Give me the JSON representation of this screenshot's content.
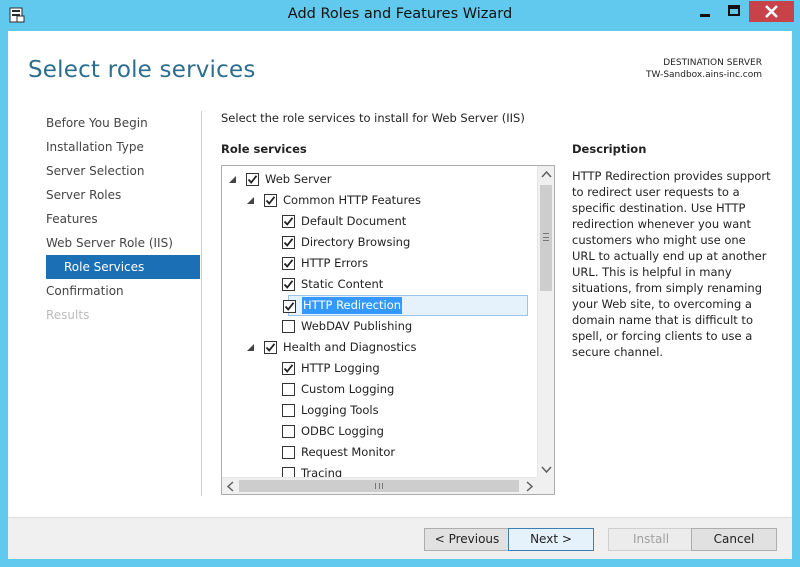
{
  "window": {
    "title": "Add Roles and Features Wizard"
  },
  "header": {
    "page_title": "Select role services",
    "destination_label": "DESTINATION SERVER",
    "destination_server": "TW-Sandbox.ains-inc.com"
  },
  "nav": {
    "items": [
      {
        "label": "Before You Begin",
        "state": "normal"
      },
      {
        "label": "Installation Type",
        "state": "normal"
      },
      {
        "label": "Server Selection",
        "state": "normal"
      },
      {
        "label": "Server Roles",
        "state": "normal"
      },
      {
        "label": "Features",
        "state": "normal"
      },
      {
        "label": "Web Server Role (IIS)",
        "state": "normal"
      },
      {
        "label": "Role Services",
        "state": "active"
      },
      {
        "label": "Confirmation",
        "state": "normal"
      },
      {
        "label": "Results",
        "state": "disabled"
      }
    ]
  },
  "main": {
    "intro": "Select the role services to install for Web Server (IIS)",
    "role_services_label": "Role services",
    "description_label": "Description",
    "description_text": "HTTP Redirection provides support to redirect user requests to a specific destination. Use HTTP redirection whenever you want customers who might use one URL to actually end up at another URL. This is helpful in many situations, from simply renaming your Web site, to overcoming a domain name that is difficult to spell, or forcing clients to use a secure channel."
  },
  "tree": {
    "rows": [
      {
        "label": "Web Server",
        "level": 0,
        "checked": true,
        "expander": "expanded"
      },
      {
        "label": "Common HTTP Features",
        "level": 1,
        "checked": true,
        "expander": "expanded"
      },
      {
        "label": "Default Document",
        "level": 2,
        "checked": true,
        "expander": "none"
      },
      {
        "label": "Directory Browsing",
        "level": 2,
        "checked": true,
        "expander": "none"
      },
      {
        "label": "HTTP Errors",
        "level": 2,
        "checked": true,
        "expander": "none"
      },
      {
        "label": "Static Content",
        "level": 2,
        "checked": true,
        "expander": "none"
      },
      {
        "label": "HTTP Redirection",
        "level": 2,
        "checked": true,
        "expander": "none",
        "selected": true
      },
      {
        "label": "WebDAV Publishing",
        "level": 2,
        "checked": false,
        "expander": "none"
      },
      {
        "label": "Health and Diagnostics",
        "level": 1,
        "checked": true,
        "expander": "expanded"
      },
      {
        "label": "HTTP Logging",
        "level": 2,
        "checked": true,
        "expander": "none"
      },
      {
        "label": "Custom Logging",
        "level": 2,
        "checked": false,
        "expander": "none"
      },
      {
        "label": "Logging Tools",
        "level": 2,
        "checked": false,
        "expander": "none"
      },
      {
        "label": "ODBC Logging",
        "level": 2,
        "checked": false,
        "expander": "none"
      },
      {
        "label": "Request Monitor",
        "level": 2,
        "checked": false,
        "expander": "none"
      },
      {
        "label": "Tracing",
        "level": 2,
        "checked": false,
        "expander": "none"
      }
    ]
  },
  "footer": {
    "previous_label": "< Previous",
    "next_label": "Next >",
    "install_label": "Install",
    "cancel_label": "Cancel"
  },
  "icons": {
    "app": "server-manager-icon",
    "minimize": "minimize-icon",
    "maximize": "maximize-icon",
    "close": "close-icon",
    "expand": "expanded-triangle-icon",
    "check": "checkmark-icon"
  },
  "colors": {
    "frame": "#62c9ee",
    "title_accent": "#2b6e8d",
    "nav_active": "#1a6fb5",
    "close_button": "#c8424a",
    "selection_highlight": "#3399ff"
  }
}
